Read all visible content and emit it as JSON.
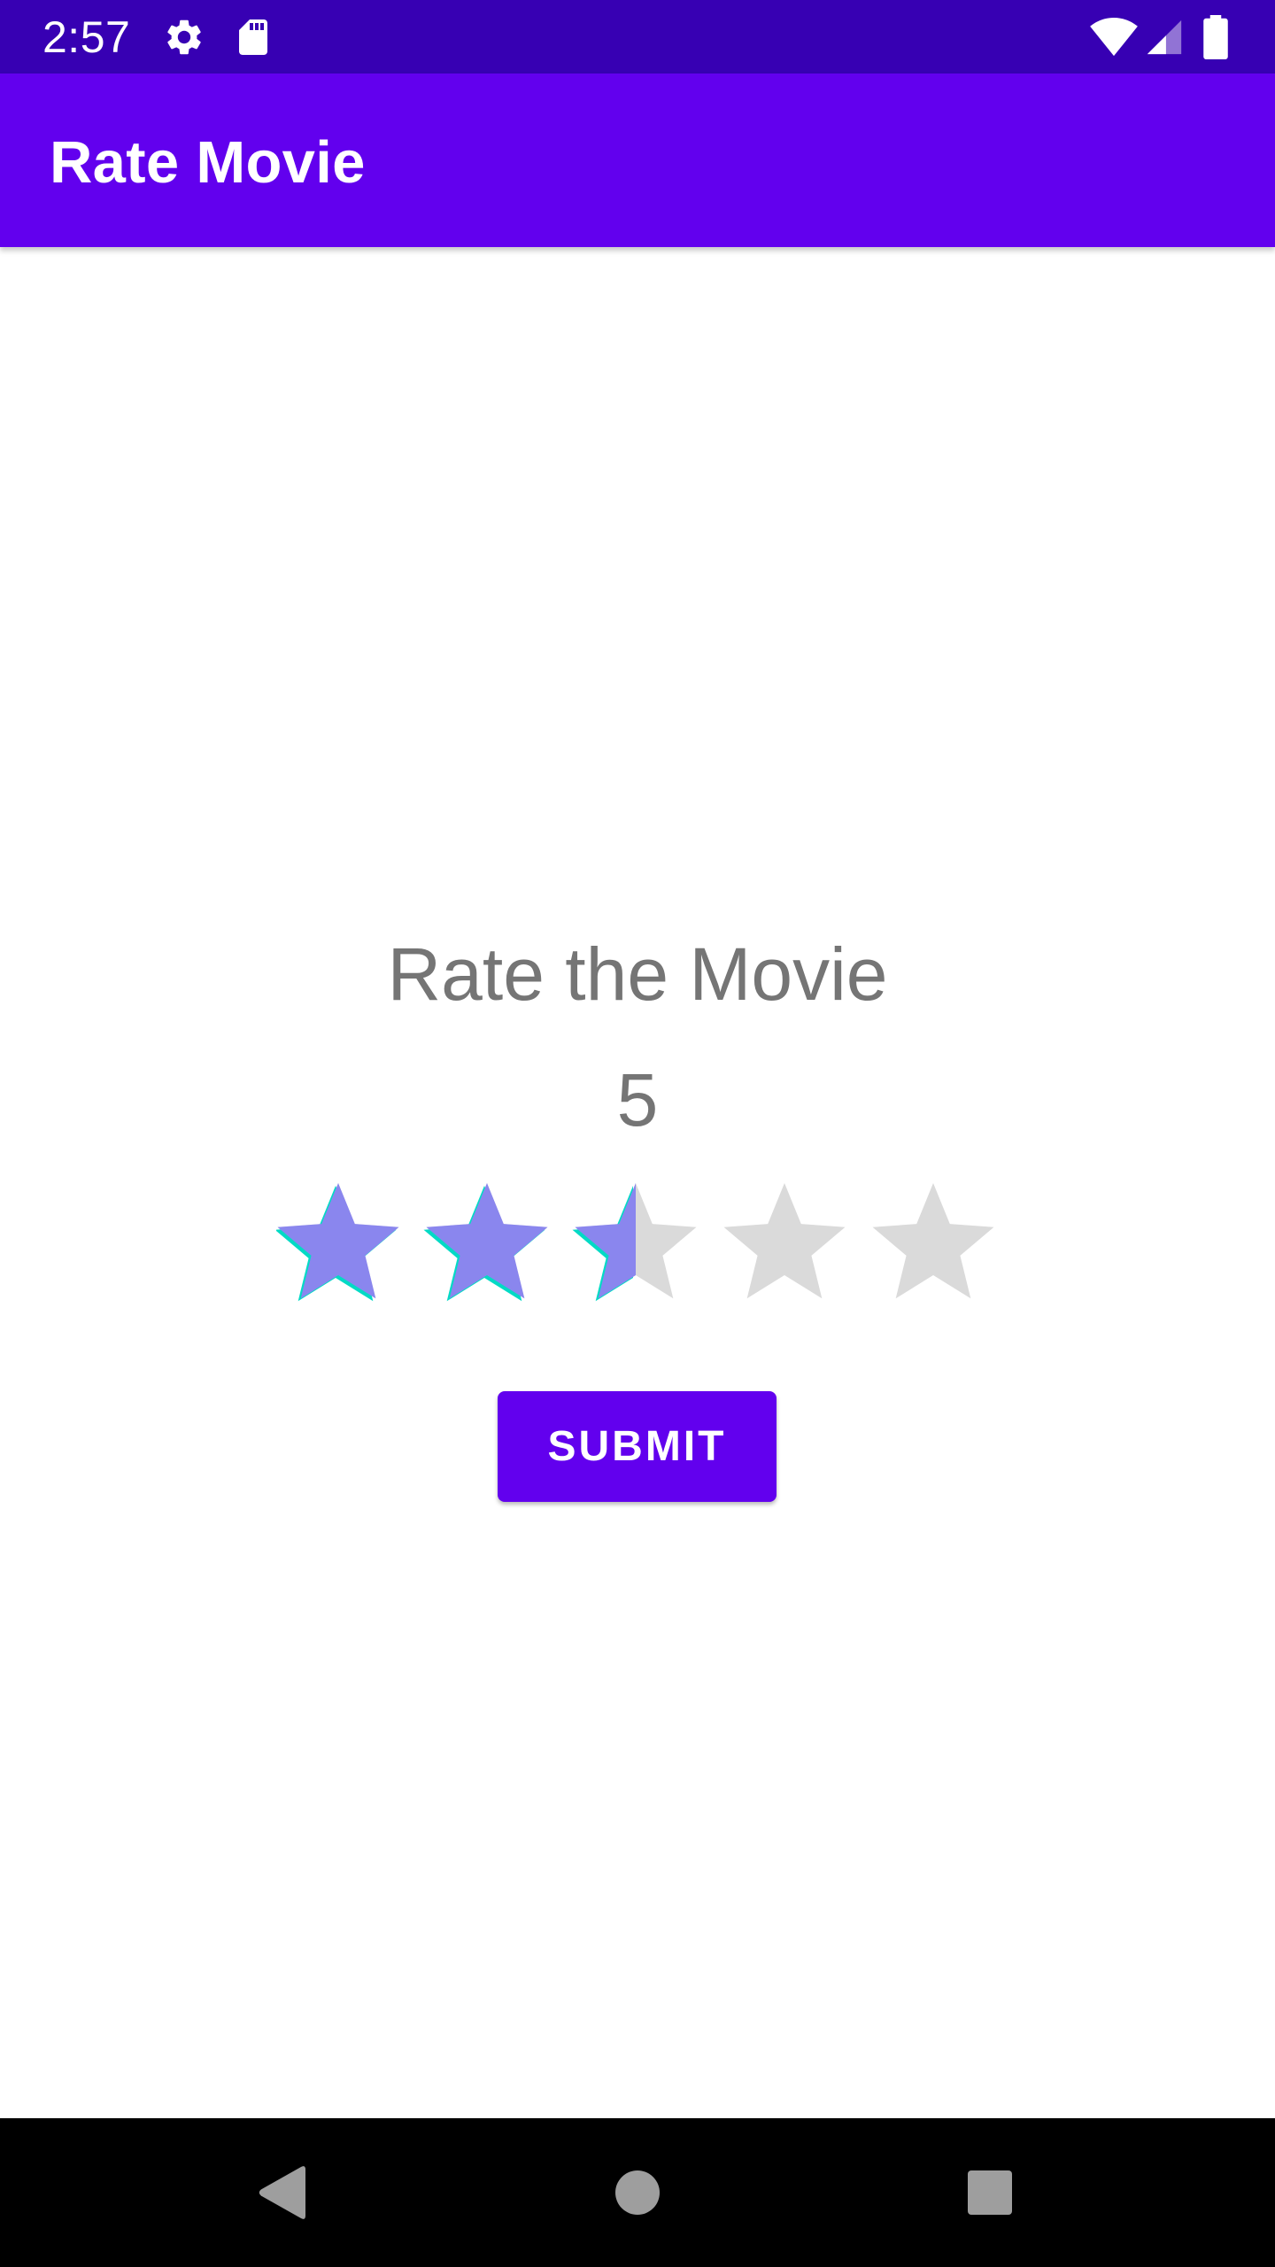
{
  "status_bar": {
    "time": "2:57",
    "icons": [
      "gear-icon",
      "sd-card-icon",
      "wifi-icon",
      "cell-signal-icon",
      "battery-icon"
    ]
  },
  "app_bar": {
    "title": "Rate Movie"
  },
  "content": {
    "heading": "Rate the Movie",
    "rating_value": "5",
    "rating": {
      "stars_total": 5,
      "stars_filled": 2.5
    },
    "submit_label": "SUBMIT"
  },
  "navigation": {
    "icons": [
      "back-icon",
      "home-icon",
      "recents-icon"
    ]
  },
  "colors": {
    "status_bar": "#3700b3",
    "app_bar": "#6200ee",
    "star_filled": "#8a86ee",
    "star_edge": "#03dac5",
    "star_empty": "#dadada",
    "text_secondary": "#757575",
    "nav_bar": "#000000",
    "nav_icon": "#9e9e9e"
  }
}
